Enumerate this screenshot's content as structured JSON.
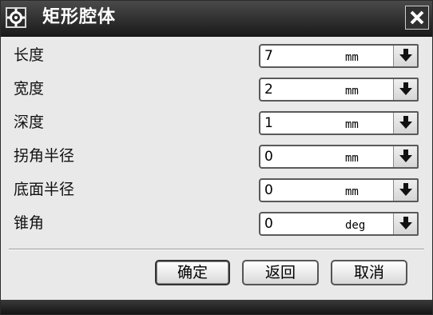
{
  "dialog": {
    "title": "矩形腔体",
    "title_icon": "gear-icon",
    "close_icon": "close-icon"
  },
  "fields": [
    {
      "label": "长度",
      "value": "7",
      "unit": "mm"
    },
    {
      "label": "宽度",
      "value": "2",
      "unit": "mm"
    },
    {
      "label": "深度",
      "value": "1",
      "unit": "mm"
    },
    {
      "label": "拐角半径",
      "value": "0",
      "unit": "mm"
    },
    {
      "label": "底面半径",
      "value": "0",
      "unit": "mm"
    },
    {
      "label": "锥角",
      "value": "0",
      "unit": "deg"
    }
  ],
  "buttons": {
    "ok": "确定",
    "back": "返回",
    "cancel": "取消"
  },
  "colors": {
    "titlebar": "#2a2a2a",
    "dialog_bg": "#e9e9e9"
  }
}
